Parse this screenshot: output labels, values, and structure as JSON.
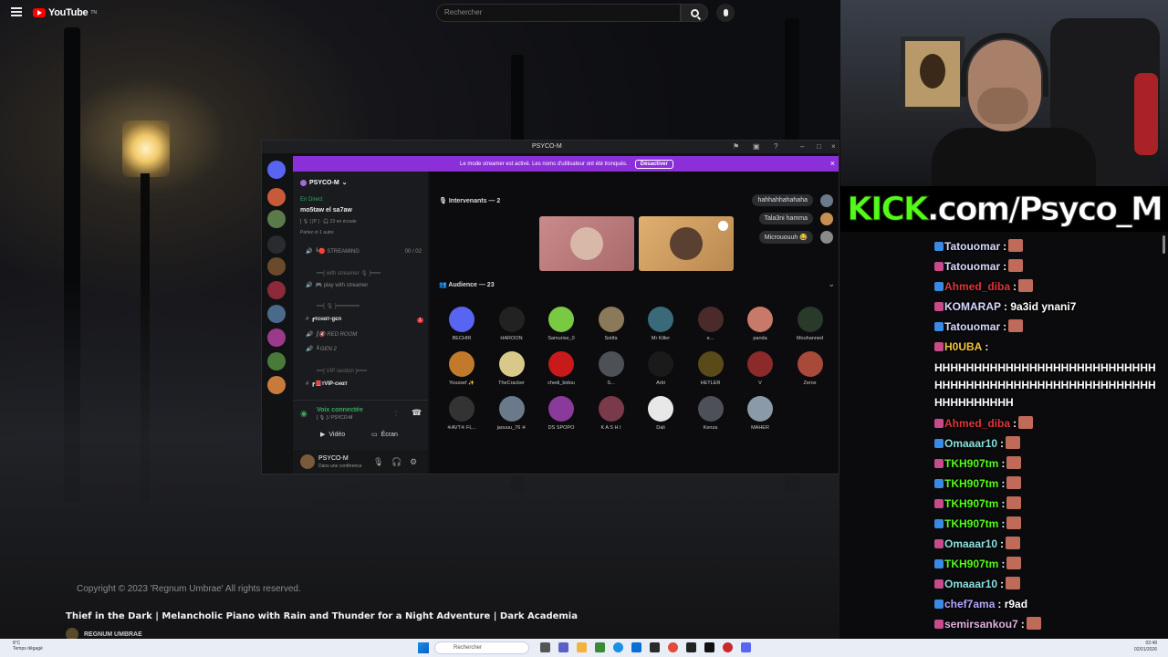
{
  "youtube": {
    "logo_text": "YouTube",
    "logo_sup": "TN",
    "search_placeholder": "Rechercher",
    "copyright": "Copyright © 2023 'Regnum Umbrae' All rights reserved.",
    "video_title": "Thief in the Dark | Melancholic Piano with Rain and Thunder for a Night Adventure | Dark Academia",
    "channel_name": "REGNUM UMBRAE"
  },
  "discord": {
    "window_title": "PSYCO-M",
    "banner_text": "Le mode streamer est activé. Les noms d'utilisateur ont été tronqués.",
    "banner_button": "Désactiver",
    "server_name": "PSYCO-M",
    "live_label": "En Direct",
    "stage_title": "mo5taw el sa7aw",
    "stage_meta": "[ 🎙 ] [P ] · 🎧 23 en écoute",
    "stage_speakers": "Parlez et 1 autre",
    "channels": [
      {
        "label": "STREAMING",
        "prefix": "┗🔴",
        "kind": "voice",
        "count": "00 / 02"
      },
      {
        "label": "━━[ with streamer 🎙 ]━━━",
        "kind": "category"
      },
      {
        "label": "play with streamer",
        "prefix": "🎮",
        "kind": "voice"
      },
      {
        "label": "━━[ 🎙 ]━━━━━━━",
        "kind": "category"
      },
      {
        "label": "тcнαт-gєn",
        "prefix": "┏",
        "kind": "text-bold",
        "badge": "1"
      },
      {
        "label": "RED ROOM",
        "prefix": "┃🔇",
        "kind": "voice"
      },
      {
        "label": "GEN 2",
        "prefix": "┗",
        "kind": "voice"
      },
      {
        "label": "━━[ VIP section ]━━━",
        "kind": "category"
      },
      {
        "label": "тVIP-cнαт",
        "prefix": "┏📕",
        "kind": "text-bold"
      }
    ],
    "voice_connected": "Voix connectée",
    "voice_sub": "[ 🎙 ] / PSYCO-M",
    "video_button": "Vidéo",
    "screen_button": "Écran",
    "user_name": "PSYCO-M",
    "user_status": "Dans une conférence",
    "speakers_label": "Intervenants — 2",
    "audience_label": "Audience — 23",
    "side_chat": [
      "hahhahhahahaha",
      "Tala3ni hamma",
      "Micrououuh 😂"
    ],
    "audience": [
      {
        "name": "BECHIR",
        "color": "#5865f2"
      },
      {
        "name": "HAROON",
        "color": "#222"
      },
      {
        "name": "Samurise_0",
        "color": "#7ac943"
      },
      {
        "name": "Sotifa",
        "color": "#8a7a5a"
      },
      {
        "name": "Mr Killer",
        "color": "#3a6a7a"
      },
      {
        "name": "e...",
        "color": "#4a2a2a"
      },
      {
        "name": "panda",
        "color": "#c87a6a"
      },
      {
        "name": "Mouhanned",
        "color": "#2a3a2a"
      },
      {
        "name": "Youssef ✨",
        "color": "#c07a2a"
      },
      {
        "name": "TheCracker",
        "color": "#d8c88a"
      },
      {
        "name": "chedi_bidou",
        "color": "#c81a1a"
      },
      {
        "name": "S...",
        "color": "#4e5058"
      },
      {
        "name": "Arbi",
        "color": "#1a1a1a"
      },
      {
        "name": "HETLER",
        "color": "#5a4a1a"
      },
      {
        "name": "V",
        "color": "#8a2a2a"
      },
      {
        "name": "Zerox",
        "color": "#a84a3a"
      },
      {
        "name": "※AVT※ FL...",
        "color": "#333"
      },
      {
        "name": "jaouuu_76 ※",
        "color": "#6a7a8a"
      },
      {
        "name": "DS SPOPO",
        "color": "#8a3a9a"
      },
      {
        "name": "K A S H I",
        "color": "#7a3a4a"
      },
      {
        "name": "Dali",
        "color": "#e8e8e8"
      },
      {
        "name": "Kenza",
        "color": "#4e5058"
      },
      {
        "name": "MAHER",
        "color": "#8a9aa8"
      }
    ]
  },
  "kick": {
    "prefix": "KICK",
    "rest": ".com/Psyco_M"
  },
  "chat": [
    {
      "user": "Tatouomar",
      "text": ":",
      "color": "#d8d8ff",
      "emote": true
    },
    {
      "user": "Tatouomar",
      "text": ":",
      "color": "#d8d8ff",
      "emote": true
    },
    {
      "user": "Ahmed_diba",
      "text": ":",
      "color": "#e0353b",
      "emote": true
    },
    {
      "user": "KOMARAP",
      "text": ": 9a3id ynani7",
      "color": "#d8d8ff",
      "emote": false
    },
    {
      "user": "Tatouomar",
      "text": ":",
      "color": "#d8d8ff",
      "emote": true
    },
    {
      "user": "H0UBA",
      "text": ":",
      "color": "#f3c43a",
      "emote": false
    },
    {
      "user": "",
      "text": "HHHHHHHHHHHHHHHHHHHHHHHHHHHHHHHHHHHHHHHHHHHHHHHHHHHHHHHHHHHHHHHHHH",
      "color": "#fff",
      "emote": false
    },
    {
      "user": "Ahmed_diba",
      "text": ":",
      "color": "#e0353b",
      "emote": true
    },
    {
      "user": "Omaaar10",
      "text": ":",
      "color": "#8ce0e0",
      "emote": true
    },
    {
      "user": "TKH907tm",
      "text": ":",
      "color": "#53fc18",
      "emote": true
    },
    {
      "user": "TKH907tm",
      "text": ":",
      "color": "#53fc18",
      "emote": true
    },
    {
      "user": "TKH907tm",
      "text": ":",
      "color": "#53fc18",
      "emote": true
    },
    {
      "user": "TKH907tm",
      "text": ":",
      "color": "#53fc18",
      "emote": true
    },
    {
      "user": "Omaaar10",
      "text": ":",
      "color": "#8ce0e0",
      "emote": true
    },
    {
      "user": "TKH907tm",
      "text": ":",
      "color": "#53fc18",
      "emote": true
    },
    {
      "user": "Omaaar10",
      "text": ":",
      "color": "#8ce0e0",
      "emote": true
    },
    {
      "user": "chef7ama",
      "text": ": r9ad",
      "color": "#b6a6ff",
      "emote": false
    },
    {
      "user": "semirsankou7",
      "text": ":",
      "color": "#e0b0e0",
      "emote": true
    }
  ],
  "taskbar": {
    "weather_temp": "8°C",
    "weather_desc": "Temps dégagé",
    "search_placeholder": "Rechercher",
    "time": "02:48",
    "date": "02/01/2026"
  }
}
